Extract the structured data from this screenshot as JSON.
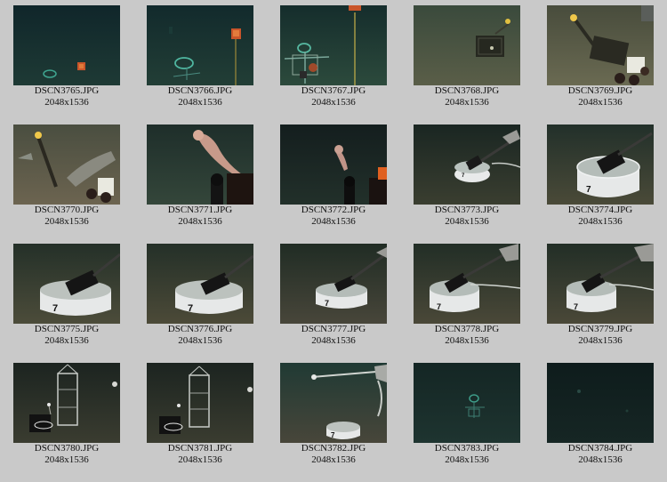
{
  "gallery": {
    "items": [
      {
        "filename": "DSCN3765.JPG",
        "dimensions": "2048x1536"
      },
      {
        "filename": "DSCN3766.JPG",
        "dimensions": "2048x1536"
      },
      {
        "filename": "DSCN3767.JPG",
        "dimensions": "2048x1536"
      },
      {
        "filename": "DSCN3768.JPG",
        "dimensions": "2048x1536"
      },
      {
        "filename": "DSCN3769.JPG",
        "dimensions": "2048x1536"
      },
      {
        "filename": "DSCN3770.JPG",
        "dimensions": "2048x1536"
      },
      {
        "filename": "DSCN3771.JPG",
        "dimensions": "2048x1536"
      },
      {
        "filename": "DSCN3772.JPG",
        "dimensions": "2048x1536"
      },
      {
        "filename": "DSCN3773.JPG",
        "dimensions": "2048x1536"
      },
      {
        "filename": "DSCN3774.JPG",
        "dimensions": "2048x1536"
      },
      {
        "filename": "DSCN3775.JPG",
        "dimensions": "2048x1536"
      },
      {
        "filename": "DSCN3776.JPG",
        "dimensions": "2048x1536"
      },
      {
        "filename": "DSCN3777.JPG",
        "dimensions": "2048x1536"
      },
      {
        "filename": "DSCN3778.JPG",
        "dimensions": "2048x1536"
      },
      {
        "filename": "DSCN3779.JPG",
        "dimensions": "2048x1536"
      },
      {
        "filename": "DSCN3780.JPG",
        "dimensions": "2048x1536"
      },
      {
        "filename": "DSCN3781.JPG",
        "dimensions": "2048x1536"
      },
      {
        "filename": "DSCN3782.JPG",
        "dimensions": "2048x1536"
      },
      {
        "filename": "DSCN3783.JPG",
        "dimensions": "2048x1536"
      },
      {
        "filename": "DSCN3784.JPG",
        "dimensions": "2048x1536"
      }
    ],
    "ring_label": "7"
  },
  "colors": {
    "page_background": "#c9c9c9",
    "caption_text": "#111111"
  }
}
